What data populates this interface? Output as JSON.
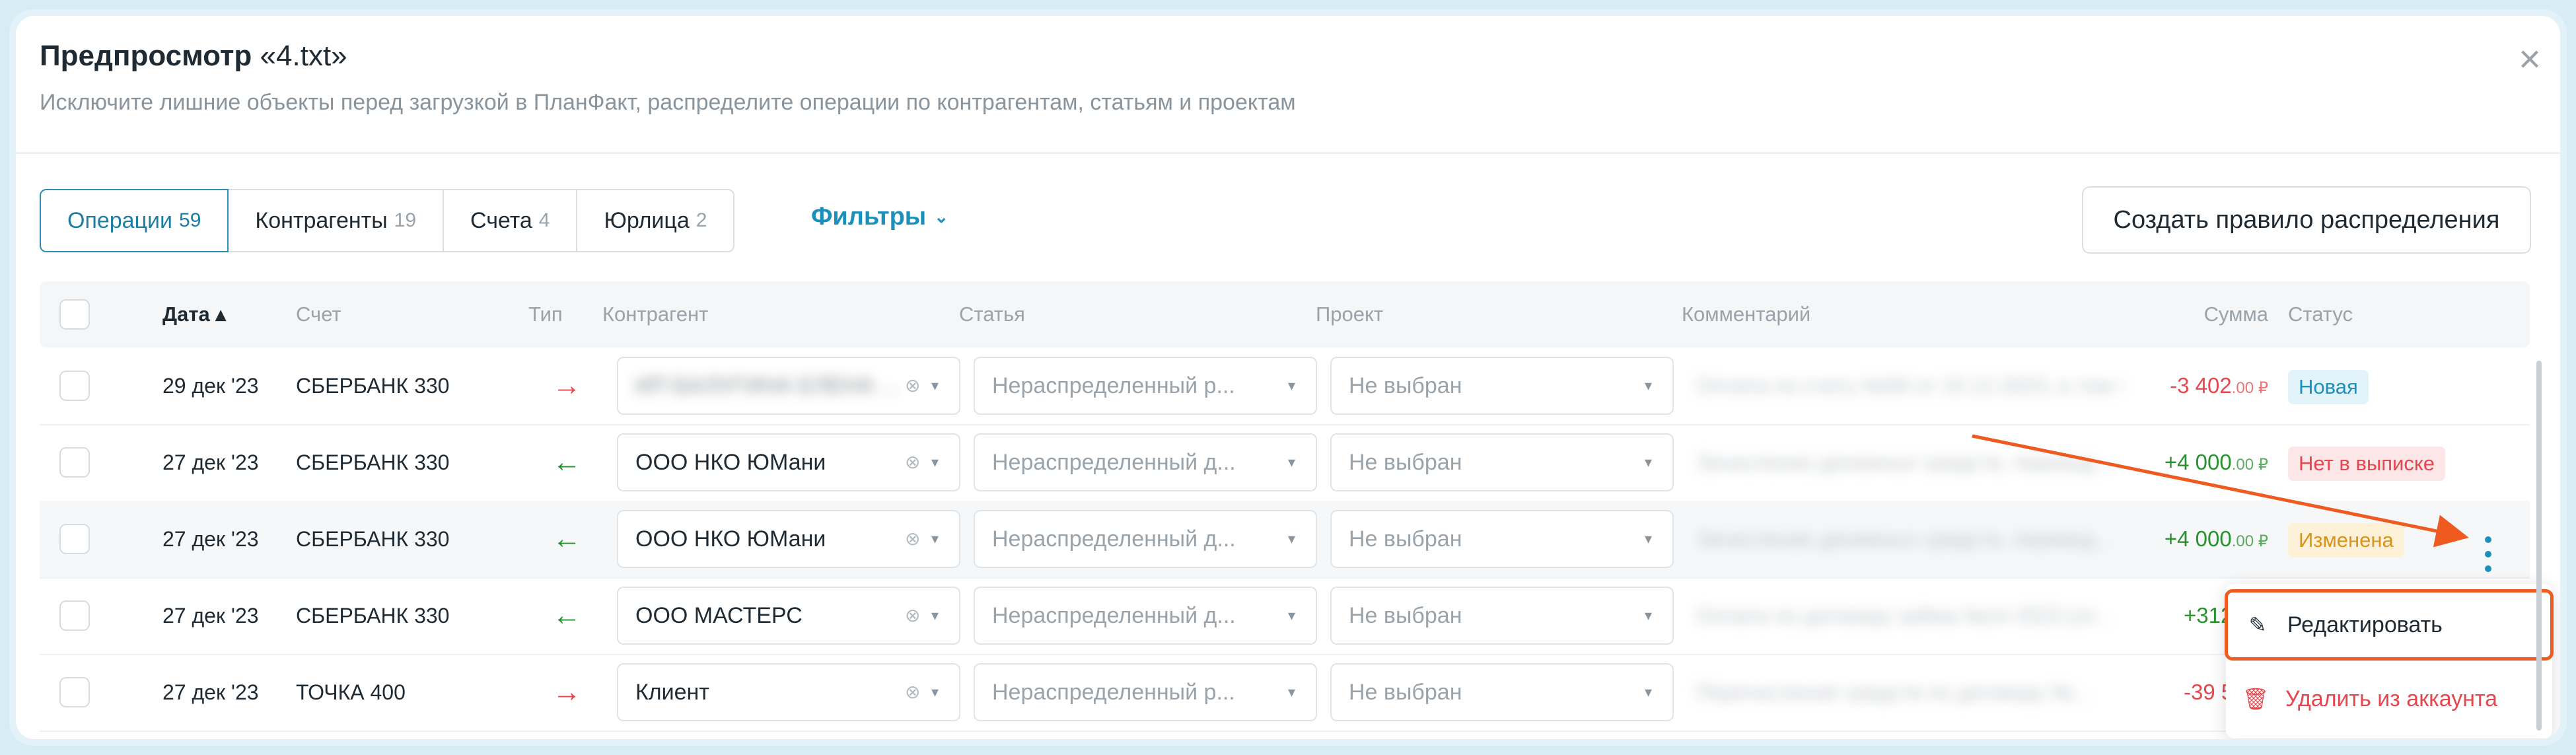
{
  "modal": {
    "title": "Предпросмотр",
    "file_name": "«4.txt»",
    "subtitle": "Исключите лишние объекты перед загрузкой в ПланФакт, распределите операции по контрагентам, статьям и проектам",
    "close_icon": "×"
  },
  "tabs": [
    {
      "label": "Операции",
      "count": "59",
      "active": true
    },
    {
      "label": "Контрагенты",
      "count": "19",
      "active": false
    },
    {
      "label": "Счета",
      "count": "4",
      "active": false
    },
    {
      "label": "Юрлица",
      "count": "2",
      "active": false
    }
  ],
  "filters_label": "Фильтры",
  "create_rule_label": "Создать правило распределения",
  "columns": {
    "date": "Дата",
    "sort_icon": "▴",
    "account": "Счет",
    "type": "Тип",
    "counterparty": "Контрагент",
    "article": "Статья",
    "project": "Проект",
    "comment": "Комментарий",
    "amount": "Сумма",
    "status": "Статус"
  },
  "rows": [
    {
      "date": "29 дек '23",
      "account": "СБЕРБАНК 330",
      "type": "out",
      "type_icon": "→",
      "counterparty": "ИП БАЛУГИНА ЕЛЕНА ...",
      "counterparty_hidden": true,
      "article": "Нераспределенный р...",
      "project": "Не выбран",
      "comment": "Оплата по счету №58 от 15.12.2023, в том чи...",
      "amount": "-3 402",
      "amount_unit": ".00 ₽",
      "amount_sign": "neg",
      "status": "Новая",
      "status_kind": "new"
    },
    {
      "date": "27 дек '23",
      "account": "СБЕРБАНК 330",
      "type": "in",
      "type_icon": "←",
      "counterparty": "ООО НКО ЮМани",
      "counterparty_hidden": false,
      "article": "Нераспределенный д...",
      "project": "Не выбран",
      "comment": "Зачисление денежных средств, перевод...",
      "amount": "+4 000",
      "amount_unit": ".00 ₽",
      "amount_sign": "pos",
      "status": "Нет в выписке",
      "status_kind": "missing"
    },
    {
      "date": "27 дек '23",
      "account": "СБЕРБАНК 330",
      "type": "in",
      "type_icon": "←",
      "counterparty": "ООО НКО ЮМани",
      "counterparty_hidden": false,
      "article": "Нераспределенный д...",
      "project": "Не выбран",
      "comment": "Зачисление денежных средств, перевод...",
      "amount": "+4 000",
      "amount_unit": ".00 ₽",
      "amount_sign": "pos",
      "status": "Изменена",
      "status_kind": "changed"
    },
    {
      "date": "27 дек '23",
      "account": "СБЕРБАНК 330",
      "type": "in",
      "type_icon": "←",
      "counterparty": "ООО МАСТЕРС",
      "counterparty_hidden": false,
      "article": "Нераспределенный д...",
      "project": "Не выбран",
      "comment": "Оплата по договору займа №14 2023 (от...",
      "amount": "+312 50",
      "amount_unit": "",
      "amount_sign": "pos",
      "status": "",
      "status_kind": ""
    },
    {
      "date": "27 дек '23",
      "account": "ТОЧКА 400",
      "type": "out",
      "type_icon": "→",
      "counterparty": "Клиент",
      "counterparty_hidden": false,
      "article": "Нераспределенный р...",
      "project": "Не выбран",
      "comment": "Перечисление средств по договору №...",
      "amount": "-39 50",
      "amount_unit": "",
      "amount_sign": "neg",
      "status": "",
      "status_kind": ""
    }
  ],
  "context_menu": {
    "edit_label": "Редактировать",
    "edit_icon": "pencil-icon",
    "delete_label": "Удалить из аккаунта",
    "delete_icon": "trash-icon"
  },
  "colors": {
    "accent": "#1d8fbb",
    "negative": "#e5474f",
    "positive": "#27922e",
    "annotation": "#ee5a1f"
  }
}
